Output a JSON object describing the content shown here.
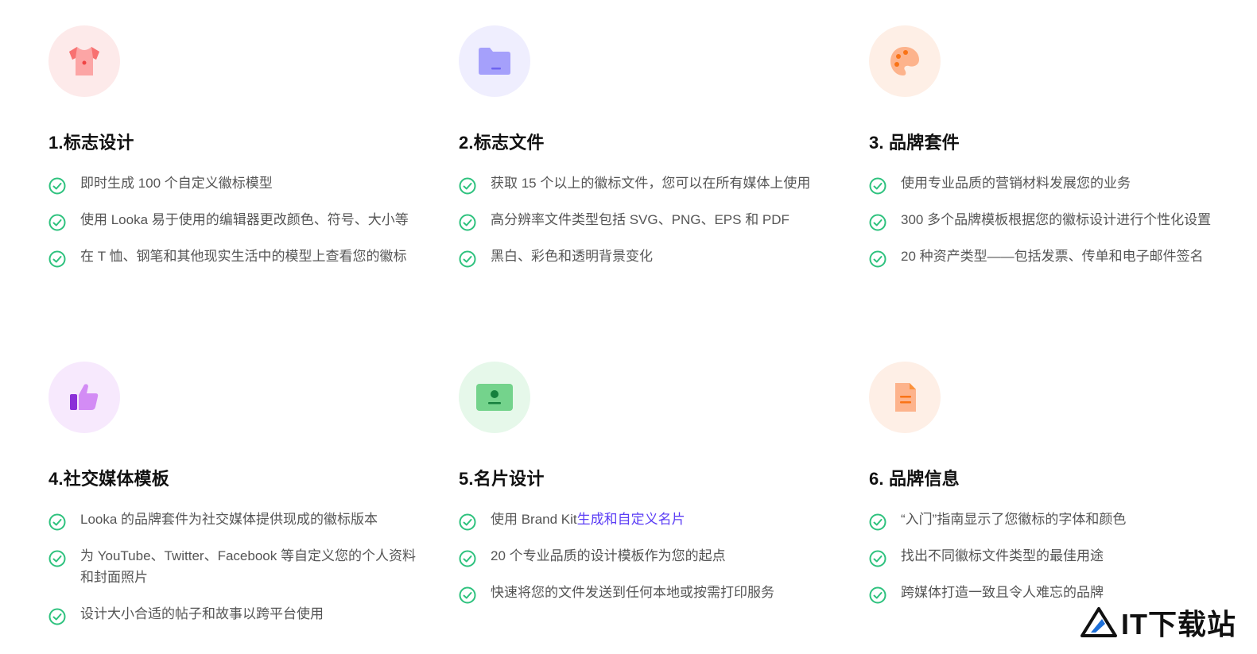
{
  "colors": {
    "check": "#2ec27e",
    "accent_link": "#5b3df5"
  },
  "cards": [
    {
      "icon": "tshirt-icon",
      "icon_bg": "#fdeaea",
      "title": "1.标志设计",
      "items": [
        "即时生成 100 个自定义徽标模型",
        "使用 Looka 易于使用的编辑器更改颜色、符号、大小等",
        "在 T 恤、钢笔和其他现实生活中的模型上查看您的徽标"
      ]
    },
    {
      "icon": "folder-icon",
      "icon_bg": "#efeefe",
      "title": "2.标志文件",
      "items": [
        "获取 15 个以上的徽标文件，您可以在所有媒体上使用",
        "高分辨率文件类型包括 SVG、PNG、EPS 和 PDF",
        "黑白、彩色和透明背景变化"
      ]
    },
    {
      "icon": "palette-icon",
      "icon_bg": "#feefe6",
      "title": "3. 品牌套件",
      "items": [
        "使用专业品质的营销材料发展您的业务",
        "300 多个品牌模板根据您的徽标设计进行个性化设置",
        "20 种资产类型——包括发票、传单和电子邮件签名"
      ]
    },
    {
      "icon": "thumbs-up-icon",
      "icon_bg": "#f7e9fd",
      "title": "4.社交媒体模板",
      "items": [
        "Looka 的品牌套件为社交媒体提供现成的徽标版本",
        "为 YouTube、Twitter、Facebook 等自定义您的个人资料和封面照片",
        "设计大小合适的帖子和故事以跨平台使用"
      ]
    },
    {
      "icon": "business-card-icon",
      "icon_bg": "#e6f8ea",
      "title": "5.名片设计",
      "items_prefix": "使用 Brand Kit",
      "items_link": "生成和自定义名片",
      "items": [
        "20 个专业品质的设计模板作为您的起点",
        "快速将您的文件发送到任何本地或按需打印服务"
      ]
    },
    {
      "icon": "document-icon",
      "icon_bg": "#feefe6",
      "title": "6. 品牌信息",
      "items": [
        "“入门”指南显示了您徽标的字体和颜色",
        "找出不同徽标文件类型的最佳用途",
        "跨媒体打造一致且令人难忘的品牌"
      ]
    }
  ],
  "watermark": {
    "text": "IT下载站"
  }
}
